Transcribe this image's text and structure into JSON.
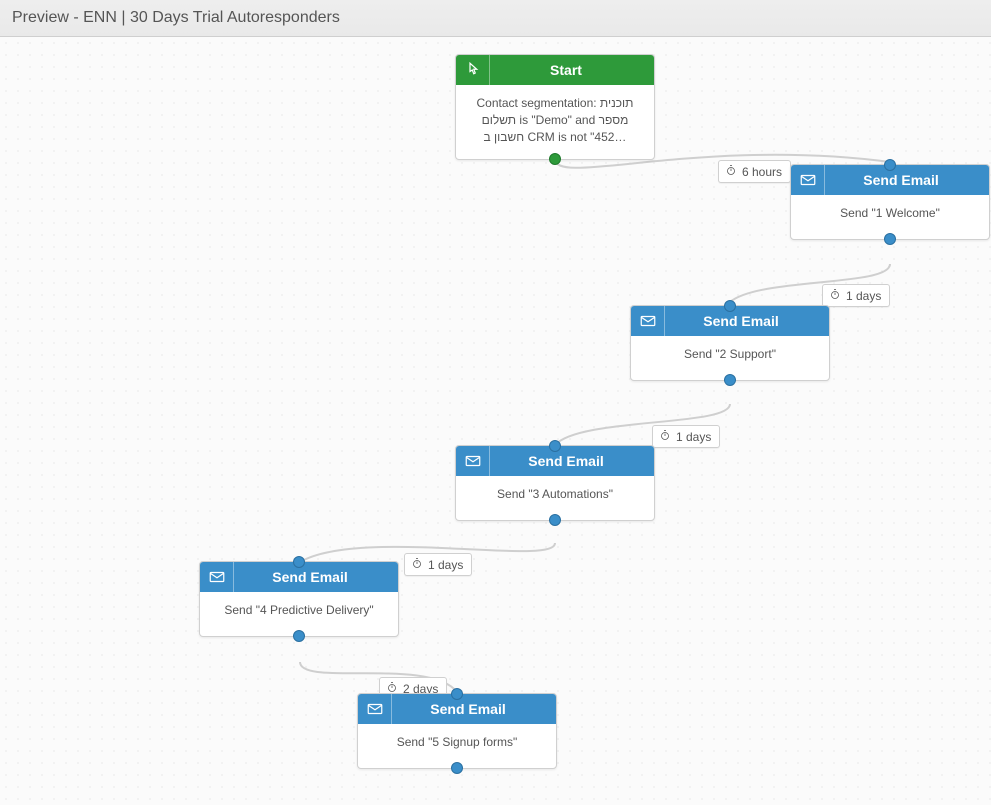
{
  "header": {
    "title": "Preview - ENN | 30 Days Trial Autoresponders"
  },
  "nodes": {
    "start": {
      "title": "Start",
      "body": "Contact segmentation: תוכנית תשלום is \"Demo\" and מספר חשבון ב CRM is not \"452…"
    },
    "email1": {
      "title": "Send Email",
      "body": "Send \"1 Welcome\""
    },
    "email2": {
      "title": "Send Email",
      "body": "Send \"2 Support\""
    },
    "email3": {
      "title": "Send Email",
      "body": "Send \"3 Automations\""
    },
    "email4": {
      "title": "Send Email",
      "body": "Send \"4 Predictive Delivery\""
    },
    "email5": {
      "title": "Send Email",
      "body": "Send \"5 Signup forms\""
    }
  },
  "delays": {
    "d1": "6 hours",
    "d2": "1 days",
    "d3": "1 days",
    "d4": "1 days",
    "d5": "2 days"
  }
}
